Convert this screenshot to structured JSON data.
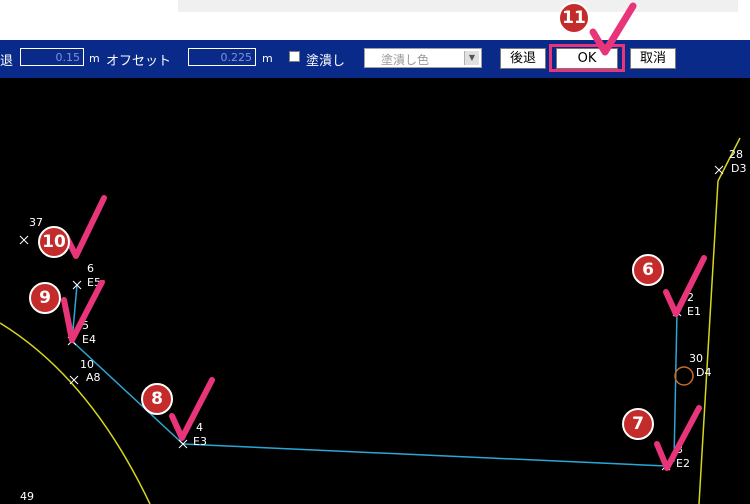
{
  "toolbar": {
    "cut_label": "退",
    "width_value": "0.15",
    "unit": "m",
    "offset_label": "オフセット",
    "offset_value": "0.225",
    "fill_label": "塗潰し",
    "fill_color_label": "塗潰し色",
    "back_button": "後退",
    "ok_button": "OK",
    "cancel_button": "取消"
  },
  "steps": [
    "6",
    "7",
    "8",
    "9",
    "10",
    "11"
  ],
  "points": [
    {
      "num": "37",
      "code": ""
    },
    {
      "num": "6",
      "code": "E5"
    },
    {
      "num": "5",
      "code": "E4"
    },
    {
      "num": "10",
      "code": "A8"
    },
    {
      "num": "4",
      "code": "E3"
    },
    {
      "num": "3",
      "code": "E2"
    },
    {
      "num": "2",
      "code": "E1"
    },
    {
      "num": "30",
      "code": "D4"
    },
    {
      "num": "28",
      "code": "D3"
    },
    {
      "num": "49",
      "code": ""
    }
  ],
  "colors": {
    "toolbar_bg": "#0a2a8a",
    "canvas_bg": "#000000",
    "polyline": "#2aa7d6",
    "boundary": "#d6d61e",
    "step_badge": "#c42b2b",
    "check": "#e8357a",
    "circle": "#c86a2a"
  }
}
